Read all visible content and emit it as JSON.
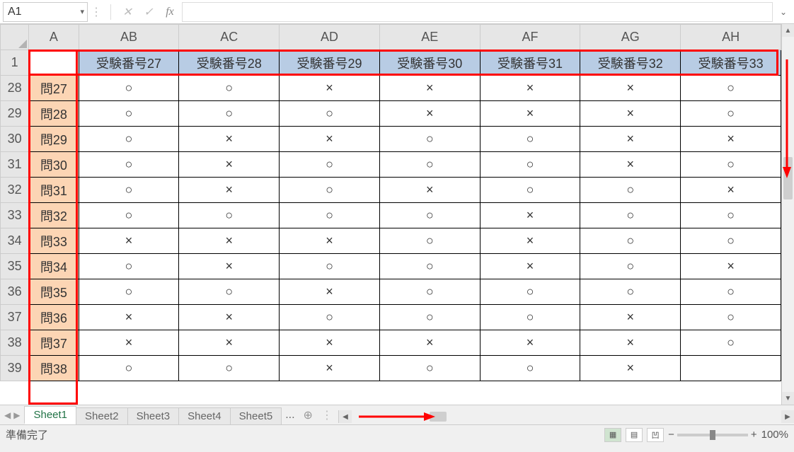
{
  "name_box": {
    "value": "A1"
  },
  "formula": {
    "value": ""
  },
  "columns_display": [
    "A",
    "AB",
    "AC",
    "AD",
    "AE",
    "AF",
    "AG",
    "AH"
  ],
  "header_row_num": "1",
  "headers": [
    "",
    "受験番号27",
    "受験番号28",
    "受験番号29",
    "受験番号30",
    "受験番号31",
    "受験番号32",
    "受験番号33"
  ],
  "rows": [
    {
      "num": "28",
      "label": "問27",
      "cells": [
        "○",
        "○",
        "×",
        "×",
        "×",
        "×",
        "○"
      ]
    },
    {
      "num": "29",
      "label": "問28",
      "cells": [
        "○",
        "○",
        "○",
        "×",
        "×",
        "×",
        "○"
      ]
    },
    {
      "num": "30",
      "label": "問29",
      "cells": [
        "○",
        "×",
        "×",
        "○",
        "○",
        "×",
        "×"
      ]
    },
    {
      "num": "31",
      "label": "問30",
      "cells": [
        "○",
        "×",
        "○",
        "○",
        "○",
        "×",
        "○"
      ]
    },
    {
      "num": "32",
      "label": "問31",
      "cells": [
        "○",
        "×",
        "○",
        "×",
        "○",
        "○",
        "×"
      ]
    },
    {
      "num": "33",
      "label": "問32",
      "cells": [
        "○",
        "○",
        "○",
        "○",
        "×",
        "○",
        "○"
      ]
    },
    {
      "num": "34",
      "label": "問33",
      "cells": [
        "×",
        "×",
        "×",
        "○",
        "×",
        "○",
        "○"
      ]
    },
    {
      "num": "35",
      "label": "問34",
      "cells": [
        "○",
        "×",
        "○",
        "○",
        "×",
        "○",
        "×"
      ]
    },
    {
      "num": "36",
      "label": "問35",
      "cells": [
        "○",
        "○",
        "×",
        "○",
        "○",
        "○",
        "○"
      ]
    },
    {
      "num": "37",
      "label": "問36",
      "cells": [
        "×",
        "×",
        "○",
        "○",
        "○",
        "×",
        "○"
      ]
    },
    {
      "num": "38",
      "label": "問37",
      "cells": [
        "×",
        "×",
        "×",
        "×",
        "×",
        "×",
        "○"
      ]
    },
    {
      "num": "39",
      "label": "問38",
      "cells": [
        "○",
        "○",
        "×",
        "○",
        "○",
        "×",
        ""
      ]
    }
  ],
  "sheets": {
    "tabs": [
      "Sheet1",
      "Sheet2",
      "Sheet3",
      "Sheet4",
      "Sheet5"
    ],
    "active": 0,
    "more": "..."
  },
  "status": {
    "text": "準備完了",
    "zoom": "100%"
  },
  "icons": {
    "cancel": "✕",
    "enter": "✓",
    "fx": "fx",
    "dropdown": "▾",
    "expand": "⌄",
    "left": "◀",
    "right": "▶",
    "up": "▲",
    "down": "▼",
    "plus": "⊕",
    "minus": "−",
    "plus2": "+"
  }
}
